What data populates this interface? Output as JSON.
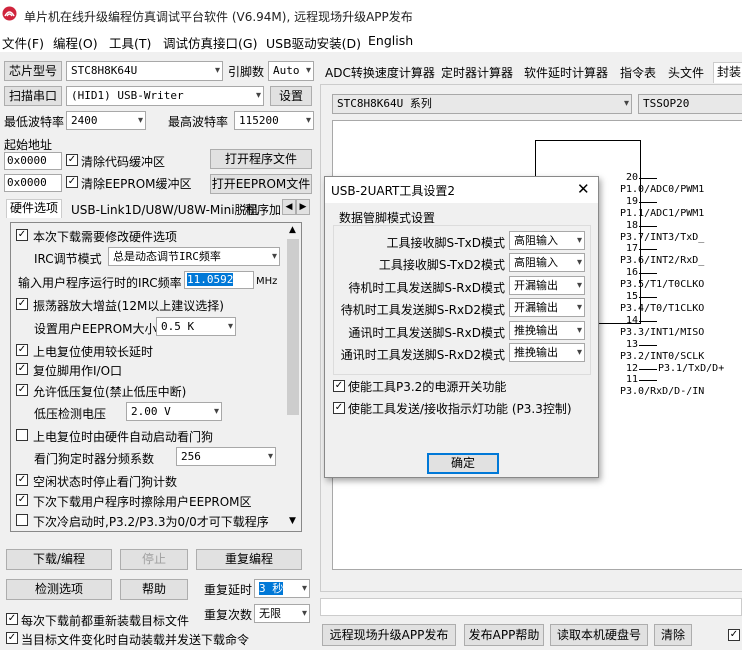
{
  "window": {
    "title": "单片机在线升级编程仿真调试平台软件 (V6.94M), 远程现场升级APP发布"
  },
  "menu": [
    "文件(F)",
    "编程(O)",
    "工具(T)",
    "调试仿真接口(G)",
    "USB驱动安装(D)",
    "English"
  ],
  "left": {
    "chip_button": "芯片型号",
    "chip_value": "STC8H8K64U",
    "pin_label": "引脚数",
    "pin_value": "Auto",
    "scan_button": "扫描串口",
    "port_value": "(HID1) USB-Writer",
    "settings_button": "设置",
    "min_baud_label": "最低波特率",
    "min_baud_value": "2400",
    "max_baud_label": "最高波特率",
    "max_baud_value": "115200",
    "start_addr_label": "起始地址",
    "addr1": "0x0000",
    "clear_code_label": "清除代码缓冲区",
    "open_prog_button": "打开程序文件",
    "addr2": "0x0000",
    "clear_eeprom_label": "清除EEPROM缓冲区",
    "open_eeprom_button": "打开EEPROM文件",
    "tabs": [
      "硬件选项",
      "USB-Link1D/U8W/U8W-Mini脱机",
      "程序加"
    ],
    "options": {
      "opt1": "本次下载需要修改硬件选项",
      "irc_mode_label": "IRC调节模式",
      "irc_mode_value": "总是动态调节IRC频率",
      "irc_freq_label": "输入用户程序运行时的IRC频率",
      "irc_freq_value": "11.0592",
      "irc_unit": "MHz",
      "opt_osc": "振荡器放大增益(12M以上建议选择)",
      "eeprom_size_label": "设置用户EEPROM大小",
      "eeprom_size_value": "0.5 K",
      "opt_reset_delay": "上电复位使用较长延时",
      "opt_reset_io": "复位脚用作I/O口",
      "opt_lvr": "允许低压复位(禁止低压中断)",
      "lvr_label": "低压检测电压",
      "lvr_value": "2.00 V",
      "opt_wdt": "上电复位时由硬件自动启动看门狗",
      "wdt_div_label": "看门狗定时器分频系数",
      "wdt_div_value": "256",
      "opt_idle_wdt": "空闲状态时停止看门狗计数",
      "opt_erase_eeprom": "下次下载用户程序时擦除用户EEPROM区",
      "opt_p32": "下次冷启动时,P3.2/P3.3为0/0才可下载程序"
    },
    "download_button": "下载/编程",
    "stop_button": "停止",
    "reprogram_button": "重复编程",
    "detect_button": "检测选项",
    "help_button": "帮助",
    "repeat_delay_label": "重复延时",
    "repeat_delay_value": "3 秒",
    "repeat_count_label": "重复次数",
    "repeat_count_value": "无限",
    "reload_label": "每次下载前都重新装载目标文件",
    "auto_send_label": "当目标文件变化时自动装载并发送下载命令"
  },
  "right": {
    "tabs": [
      "ADC转换速度计算器",
      "定时器计算器",
      "软件延时计算器",
      "指令表",
      "头文件",
      "封装"
    ],
    "series_value": "STC8H8K64U 系列",
    "package_value": "TSSOP20",
    "pin_rows": [
      {
        "num": "20",
        "name": "P1.0/ADC0/PWM1"
      },
      {
        "num": "19",
        "name": "P1.1/ADC1/PWM1"
      },
      {
        "num": "18",
        "name": "P3.7/INT3/TxD_"
      },
      {
        "num": "17",
        "name": "P3.6/INT2/RxD_"
      },
      {
        "num": "16",
        "name": "P3.5/T1/T0CLKO"
      },
      {
        "num": "15",
        "name": "P3.4/T0/T1CLKO"
      },
      {
        "num": "14",
        "name": "P3.3/INT1/MISO"
      },
      {
        "num": "13",
        "name": "P3.2/INT0/SCLK"
      },
      {
        "num": "12",
        "name": "P3.1/TxD/D+"
      },
      {
        "num": "11",
        "name": "P3.0/RxD/D-/IN"
      }
    ],
    "bottom_buttons": [
      "远程现场升级APP发布",
      "发布APP帮助",
      "读取本机硬盘号",
      "清除"
    ]
  },
  "dialog": {
    "title": "USB-2UART工具设置2",
    "group_label": "数据管脚模式设置",
    "rows": [
      {
        "label": "工具接收脚S-TxD模式",
        "value": "高阻输入"
      },
      {
        "label": "工具接收脚S-TxD2模式",
        "value": "高阻输入"
      },
      {
        "label": "待机时工具发送脚S-RxD模式",
        "value": "开漏输出"
      },
      {
        "label": "待机时工具发送脚S-RxD2模式",
        "value": "开漏输出"
      },
      {
        "label": "通讯时工具发送脚S-RxD模式",
        "value": "推挽输出"
      },
      {
        "label": "通讯时工具发送脚S-RxD2模式",
        "value": "推挽输出"
      }
    ],
    "check1": "使能工具P3.2的电源开关功能",
    "check2": "使能工具发送/接收指示灯功能 (P3.3控制)",
    "ok_button": "确定"
  }
}
